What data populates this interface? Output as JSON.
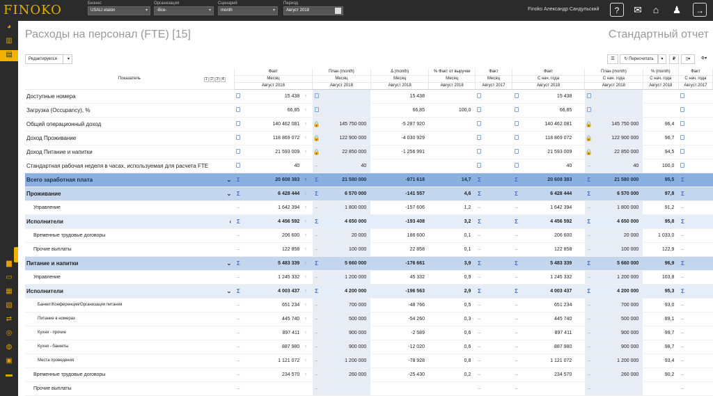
{
  "app": {
    "logo": "FINOKO",
    "filters": {
      "business": {
        "caption": "Бизнес",
        "value": "USALI etalon"
      },
      "organization": {
        "caption": "Организация",
        "value": "-Все-"
      },
      "scenario": {
        "caption": "Сценарий",
        "value": "month"
      },
      "period": {
        "caption": "Период",
        "value": "Август 2018"
      }
    },
    "user": "Finoko Александр Сандульский",
    "top_icons": [
      "help-icon",
      "chat-icon",
      "home-icon",
      "pawn-icon",
      "logout-icon"
    ]
  },
  "sidebar": {
    "icons": [
      "dashboard-icon",
      "bank-icon",
      "reports-icon",
      "bar-chart-icon",
      "presentation-icon",
      "calculator-icon",
      "receipt-icon",
      "transfer-icon",
      "coins-icon",
      "database-icon",
      "calendar-icon",
      "wallet-icon"
    ]
  },
  "page": {
    "title": "Расходы на персонал (FTE) [15]",
    "report_type": "Стандартный отчет"
  },
  "toolbar": {
    "edit_label": "Редактируется",
    "recalc_label": "Пересчитать",
    "currency_symbol": "₽"
  },
  "table": {
    "indicator_header": "Показатель",
    "levels": [
      "1",
      "2",
      "3",
      "4"
    ],
    "columns": [
      {
        "h1": "Факт",
        "h2": "Месяц",
        "h3": "Август 2018"
      },
      {
        "h1": "План (month)",
        "h2": "Месяц",
        "h3": "Август 2018"
      },
      {
        "h1": "Δ (month)",
        "h2": "Месяц",
        "h3": "Август 2018"
      },
      {
        "h1": "% Факт от выручки",
        "h2": "Месяц",
        "h3": "Август 2018"
      },
      {
        "h1": "Факт",
        "h2": "Месяц",
        "h3": "Август 2017"
      },
      {
        "h1": "Факт",
        "h2": "С нач. года",
        "h3": "Август 2018"
      },
      {
        "h1": "План (month)",
        "h2": "С нач. года",
        "h3": "Август 2018"
      },
      {
        "h1": "% (month)",
        "h2": "С нач. года",
        "h3": "Август 2018"
      },
      {
        "h1": "Факт",
        "h2": "С нач. года",
        "h3": "Август 2017"
      }
    ],
    "rows": [
      {
        "name": "Доступные номера",
        "style": "top",
        "v": [
          "15 438",
          "",
          "15 438",
          "",
          "",
          "15 438",
          "",
          "",
          ""
        ]
      },
      {
        "name": "Загрузка (Occupancy), %",
        "style": "top",
        "v": [
          "66,85",
          "",
          "66,85",
          "100,0",
          "",
          "66,85",
          "",
          "",
          ""
        ]
      },
      {
        "name": "Общий операционный доход",
        "style": "top",
        "v": [
          "140 462 081",
          "145 750 000",
          "-5 287 920",
          "",
          "",
          "140 462 081",
          "145 750 000",
          "96,4",
          ""
        ]
      },
      {
        "name": "Доход Проживание",
        "style": "top",
        "v": [
          "118 869 072",
          "122 900 000",
          "-4 030 929",
          "",
          "",
          "118 869 072",
          "122 900 000",
          "96,7",
          ""
        ]
      },
      {
        "name": "Доход Питание и напитки",
        "style": "top",
        "v": [
          "21 593 009",
          "22 850 000",
          "-1 256 991",
          "",
          "",
          "21 593 009",
          "22 850 000",
          "94,5",
          ""
        ]
      },
      {
        "name": "Стандартная рабочая неделя в часах, используемая для расчета FTE",
        "style": "top",
        "v": [
          "40",
          "40",
          "",
          "",
          "",
          "40",
          "40",
          "100,0",
          ""
        ]
      },
      {
        "name": "Всего заработная плата",
        "style": "total",
        "v": [
          "20 608 383",
          "21 580 000",
          "-971 618",
          "14,7",
          "",
          "20 608 383",
          "21 580 000",
          "95,5",
          ""
        ]
      },
      {
        "name": "Проживание",
        "style": "grp",
        "v": [
          "6 428 444",
          "6 570 000",
          "-141 557",
          "4,6",
          "",
          "6 428 444",
          "6 570 000",
          "97,8",
          ""
        ]
      },
      {
        "name": "Управление",
        "style": "l2",
        "v": [
          "1 642 394",
          "1 800 000",
          "-157 606",
          "1,2",
          "",
          "1 642 394",
          "1 800 000",
          "91,2",
          ""
        ]
      },
      {
        "name": "Исполнители",
        "style": "sub",
        "v": [
          "4 456 592",
          "4 650 000",
          "-193 408",
          "3,2",
          "",
          "4 456 592",
          "4 650 000",
          "95,8",
          ""
        ]
      },
      {
        "name": "Временные трудовые договоры",
        "style": "l2",
        "v": [
          "206 600",
          "20 000",
          "186 600",
          "0,1",
          "",
          "206 600",
          "20 000",
          "1 033,0",
          ""
        ]
      },
      {
        "name": "Прочие выплаты",
        "style": "l2",
        "v": [
          "122 858",
          "100 000",
          "22 858",
          "0,1",
          "",
          "122 858",
          "100 000",
          "122,9",
          ""
        ]
      },
      {
        "name": "Питание и напитки",
        "style": "grp",
        "v": [
          "5 483 339",
          "5 660 000",
          "-176 661",
          "3,9",
          "",
          "5 483 339",
          "5 660 000",
          "96,9",
          ""
        ]
      },
      {
        "name": "Управление",
        "style": "l2",
        "v": [
          "1 245 332",
          "1 200 000",
          "45 332",
          "0,9",
          "",
          "1 245 332",
          "1 200 000",
          "103,8",
          ""
        ]
      },
      {
        "name": "Исполнители",
        "style": "sub",
        "v": [
          "4 003 437",
          "4 200 000",
          "-196 563",
          "2,9",
          "",
          "4 003 437",
          "4 200 000",
          "95,3",
          ""
        ]
      },
      {
        "name": "Банкет/Конференция/Организация питания",
        "style": "l3",
        "v": [
          "651 234",
          "700 000",
          "-48 766",
          "0,5",
          "",
          "651 234",
          "700 000",
          "93,0",
          ""
        ]
      },
      {
        "name": "Питание в номерах",
        "style": "l3",
        "v": [
          "445 740",
          "500 000",
          "-54 260",
          "0,3",
          "",
          "445 740",
          "500 000",
          "89,1",
          ""
        ]
      },
      {
        "name": "Кухня - прочие",
        "style": "l3",
        "v": [
          "897 411",
          "900 000",
          "-2 589",
          "0,6",
          "",
          "897 411",
          "900 000",
          "99,7",
          ""
        ]
      },
      {
        "name": "Кухня - банкеты",
        "style": "l3",
        "v": [
          "887 980",
          "900 000",
          "-12 020",
          "0,6",
          "",
          "887 980",
          "900 000",
          "98,7",
          ""
        ]
      },
      {
        "name": "Места проведения",
        "style": "l3",
        "v": [
          "1 121 072",
          "1 200 000",
          "-78 928",
          "0,8",
          "",
          "1 121 072",
          "1 200 000",
          "93,4",
          ""
        ]
      },
      {
        "name": "Временные трудовые договоры",
        "style": "l2",
        "v": [
          "234 570",
          "260 000",
          "-25 430",
          "0,2",
          "",
          "234 570",
          "260 000",
          "90,2",
          ""
        ]
      },
      {
        "name": "Прочие выплаты",
        "style": "l2",
        "v": [
          "",
          "",
          "",
          "",
          "",
          "",
          "",
          "",
          ""
        ]
      }
    ]
  }
}
